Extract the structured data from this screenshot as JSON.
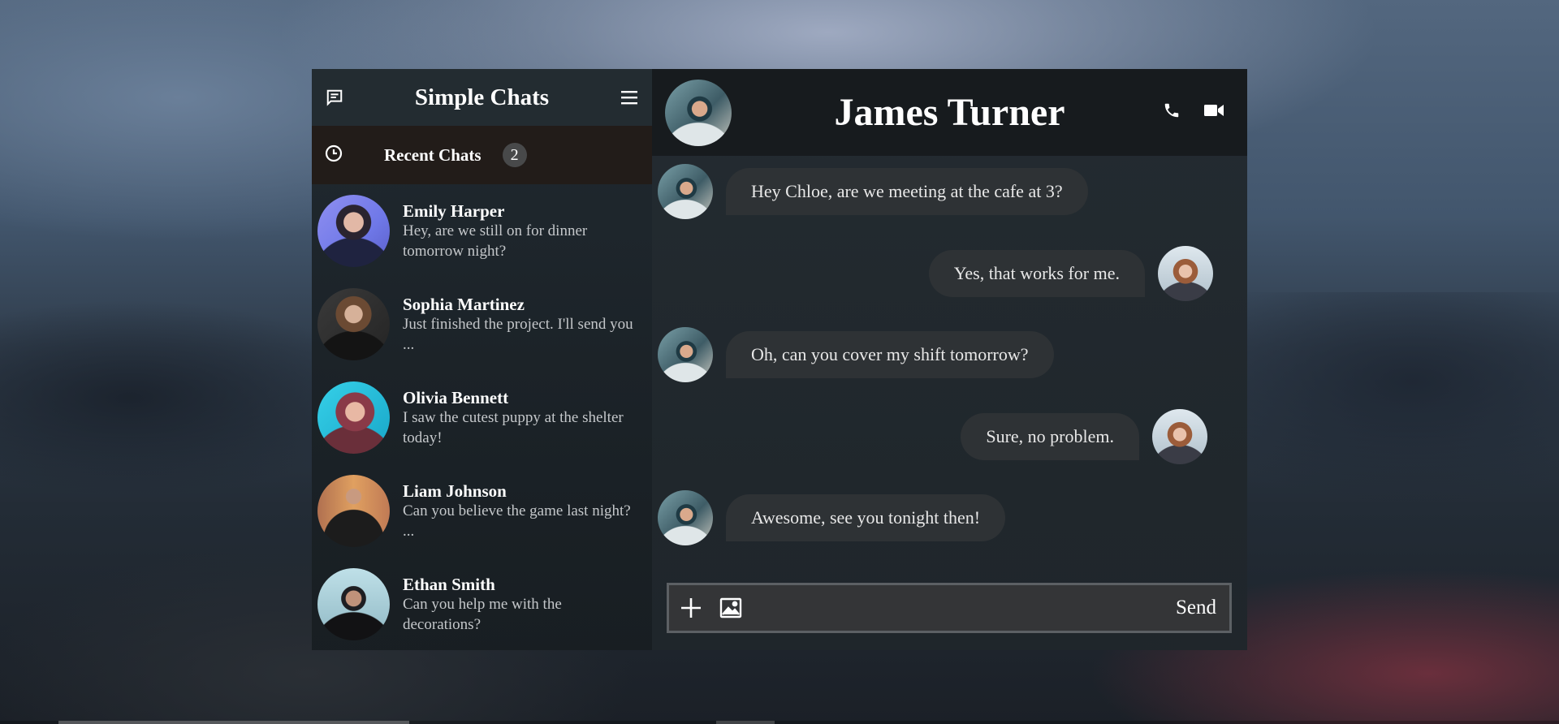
{
  "sidebar": {
    "title": "Simple Chats",
    "recent_label": "Recent Chats",
    "recent_count": "2",
    "chats": [
      {
        "name": "Emily Harper",
        "preview": "Hey, are we still on for dinner tomorrow night?"
      },
      {
        "name": "Sophia Martinez",
        "preview": "Just finished the project. I'll send you ..."
      },
      {
        "name": "Olivia Bennett",
        "preview": "I saw the cutest puppy at the shelter today!"
      },
      {
        "name": "Liam Johnson",
        "preview": "Can you believe the game last night? ..."
      },
      {
        "name": "Ethan Smith",
        "preview": "Can you help me with the decorations?"
      }
    ]
  },
  "conversation": {
    "contact_name": "James Turner",
    "messages": [
      {
        "direction": "in",
        "text": "Hey Chloe, are we meeting at the cafe at 3?"
      },
      {
        "direction": "out",
        "text": "Yes, that works for me."
      },
      {
        "direction": "in",
        "text": "Oh, can you cover my shift tomorrow?"
      },
      {
        "direction": "out",
        "text": "Sure, no problem."
      },
      {
        "direction": "in",
        "text": "Awesome, see you tonight then!"
      }
    ]
  },
  "composer": {
    "placeholder": "",
    "send_label": "Send"
  },
  "icons": {
    "new_chat": "message-square-icon",
    "menu": "hamburger-menu-icon",
    "recent": "clock-icon",
    "call": "phone-icon",
    "video": "video-camera-icon",
    "attach": "plus-icon",
    "image": "image-icon"
  }
}
